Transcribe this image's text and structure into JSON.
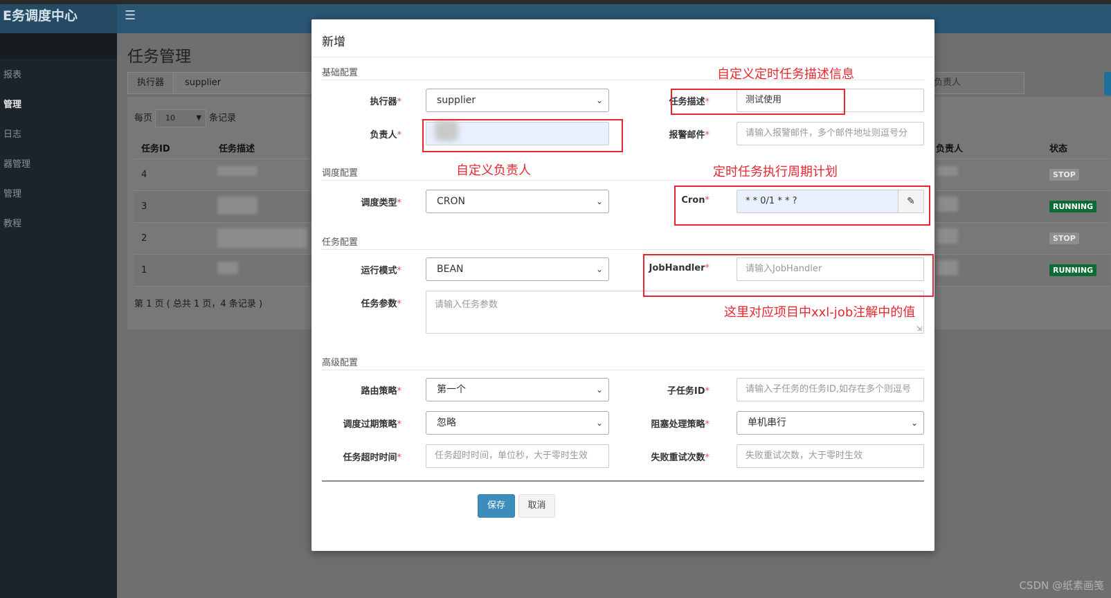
{
  "app": {
    "brand": "E务调度中心",
    "menu_icon": "menu-icon",
    "sidebar": [
      "报表",
      "管理",
      "日志",
      "器管理",
      "管理",
      "教程"
    ],
    "page_title": "任务管理",
    "filter_label": "执行器",
    "filter_value": "supplier",
    "owner_search_placeholder": "入负责人",
    "page_size_prefix": "每页",
    "page_size_value": "10",
    "page_size_suffix": "条记录",
    "table": {
      "headers": {
        "id": "任务ID",
        "desc": "任务描述",
        "owner": "负责人",
        "status": "状态"
      },
      "rows": [
        {
          "id": "4",
          "status": "STOP"
        },
        {
          "id": "3",
          "status": "RUNNING"
        },
        {
          "id": "2",
          "status": "STOP"
        },
        {
          "id": "1",
          "status": "RUNNING"
        }
      ]
    },
    "pager": "第 1 页 ( 总共 1 页，4 条记录 )"
  },
  "modal": {
    "title": "新增",
    "sections": {
      "basic": "基础配置",
      "schedule": "调度配置",
      "task": "任务配置",
      "advanced": "高级配置"
    },
    "fields": {
      "executor": {
        "label": "执行器",
        "value": "supplier"
      },
      "job_desc": {
        "label": "任务描述",
        "value": "测试使用"
      },
      "author": {
        "label": "负责人",
        "value": ""
      },
      "alarm_email": {
        "label": "报警邮件",
        "placeholder": "请输入报警邮件，多个邮件地址则逗号分"
      },
      "schedule_type": {
        "label": "调度类型",
        "value": "CRON"
      },
      "cron": {
        "label": "Cron",
        "value": "* * 0/1 * * ?",
        "icon": "edit-icon"
      },
      "run_mode": {
        "label": "运行模式",
        "value": "BEAN"
      },
      "job_handler": {
        "label": "JobHandler",
        "placeholder": "请输入JobHandler"
      },
      "job_param": {
        "label": "任务参数",
        "placeholder": "请输入任务参数"
      },
      "route_strategy": {
        "label": "路由策略",
        "value": "第一个"
      },
      "child_job": {
        "label": "子任务ID",
        "placeholder": "请输入子任务的任务ID,如存在多个则逗号"
      },
      "misfire_strategy": {
        "label": "调度过期策略",
        "value": "忽略"
      },
      "block_strategy": {
        "label": "阻塞处理策略",
        "value": "单机串行"
      },
      "timeout": {
        "label": "任务超时时间",
        "placeholder": "任务超时时间，单位秒，大于零时生效"
      },
      "fail_retry": {
        "label": "失败重试次数",
        "placeholder": "失败重试次数，大于零时生效"
      }
    },
    "buttons": {
      "save": "保存",
      "cancel": "取消"
    }
  },
  "annotations": {
    "desc_note": "自定义定时任务描述信息",
    "owner_note": "自定义负责人",
    "cron_note": "定时任务执行周期计划",
    "handler_note": "这里对应项目中xxl-job注解中的值"
  },
  "watermark": "CSDN @纸素画笺",
  "colors": {
    "annotation": "#e8262f",
    "primary_button": "#3c8dbc",
    "running": "#0c6b32",
    "navbar": "#2a5573"
  }
}
